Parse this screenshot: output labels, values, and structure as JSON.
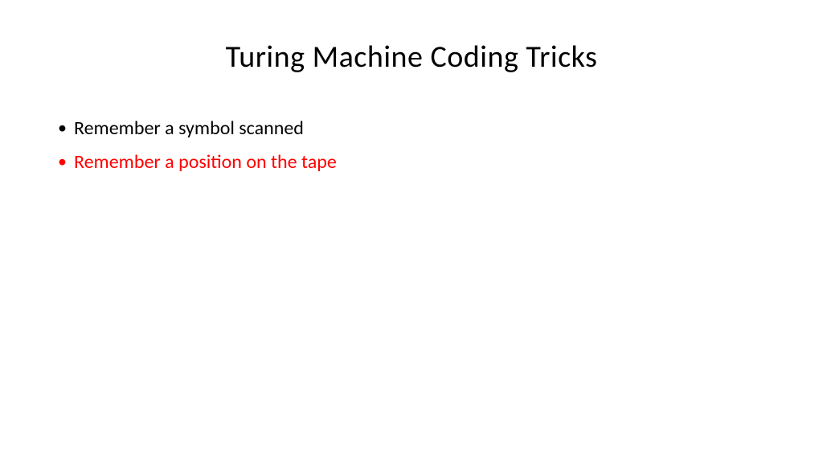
{
  "slide": {
    "title": "Turing Machine Coding Tricks",
    "bullets": [
      {
        "text": "Remember a symbol scanned",
        "color": "black"
      },
      {
        "text": "Remember a position on the tape",
        "color": "red"
      }
    ]
  }
}
